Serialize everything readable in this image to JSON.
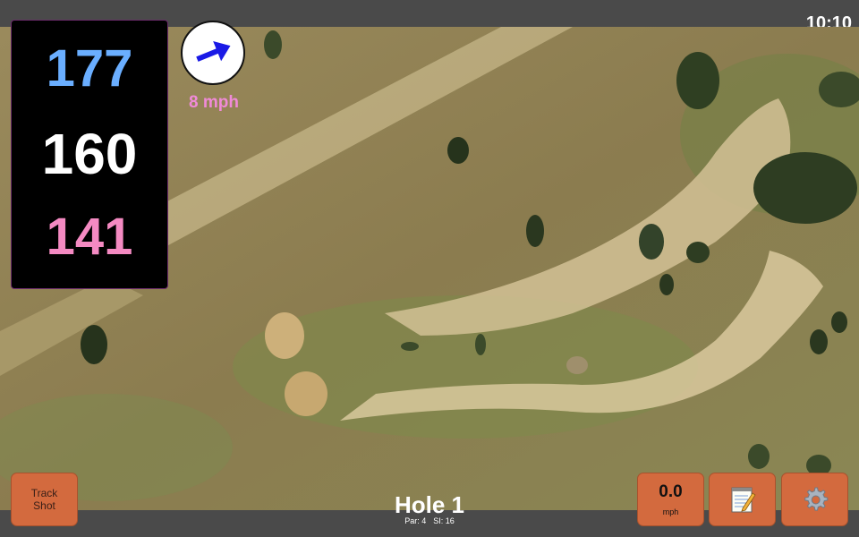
{
  "clock": "10:10",
  "distances": {
    "back": "177",
    "middle": "160",
    "front": "141",
    "colors": {
      "back": "#6aaeff",
      "middle": "#ffffff",
      "front": "#f48ac2"
    }
  },
  "wind": {
    "icon": "wind-arrow-icon",
    "speed_label": "8 mph",
    "color": "#f08ad8",
    "arrow_color": "#1a1ae6"
  },
  "track_button": {
    "line1": "Track",
    "line2": "Shot"
  },
  "speed_button": {
    "value": "0.0",
    "unit": "mph"
  },
  "notes_button": {
    "icon": "notepad-icon"
  },
  "settings_button": {
    "icon": "gear-icon"
  },
  "hole": {
    "title": "Hole 1",
    "par_label": "Par: 4",
    "si_label": "SI: 16"
  },
  "colors": {
    "button": "#d36a3e",
    "bar": "#4a4a4a"
  }
}
